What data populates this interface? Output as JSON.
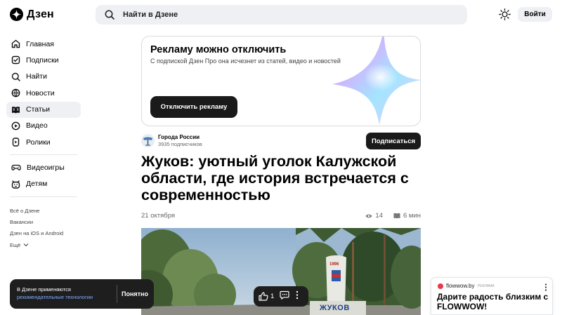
{
  "header": {
    "logo_text": "Дзен",
    "search_placeholder": "Найти в Дзене",
    "login_label": "Войти"
  },
  "sidebar": {
    "items": [
      {
        "label": "Главная",
        "icon": "home-icon"
      },
      {
        "label": "Подписки",
        "icon": "subscriptions-icon"
      },
      {
        "label": "Найти",
        "icon": "search-icon"
      },
      {
        "label": "Новости",
        "icon": "news-icon"
      },
      {
        "label": "Статьи",
        "icon": "articles-icon",
        "active": true
      },
      {
        "label": "Видео",
        "icon": "video-icon"
      },
      {
        "label": "Ролики",
        "icon": "shorts-icon"
      },
      {
        "label": "Видеоигры",
        "icon": "gamepad-icon"
      },
      {
        "label": "Детям",
        "icon": "kids-icon"
      }
    ],
    "footer": {
      "about": "Всё о Дзене",
      "jobs": "Вакансии",
      "apps": "Дзен на iOS и Android",
      "more": "Ещё"
    }
  },
  "ad": {
    "title": "Рекламу можно отключить",
    "subtitle": "С подпиской Дзен Про она исчезнет из статей, видео и новостей",
    "button": "Отключить рекламу"
  },
  "channel": {
    "name": "Города России",
    "subscribers": "3935 подписчиков",
    "subscribe_label": "Подписаться"
  },
  "article": {
    "title": "Жуков: уютный уголок Калужской области, где история встречается с современностью",
    "date": "21 октября",
    "views": "14",
    "read_time": "6 мин",
    "photo_sign_text": "ЖУКОВ",
    "photo_sign_year": "1996"
  },
  "cookie": {
    "text": "В Дзене применяются",
    "link": "рекомендательные технологии",
    "ok_label": "Понятно"
  },
  "reactions": {
    "likes": "1"
  },
  "promo": {
    "site": "flowwow.by",
    "tag": "Реклама",
    "title": "Дарите радость близким с FLOWWOW!"
  },
  "colors": {
    "accent_dark": "#1a1a1a",
    "surface": "#eef0f3",
    "link": "#80adff",
    "promo_brand": "#e8384a"
  }
}
